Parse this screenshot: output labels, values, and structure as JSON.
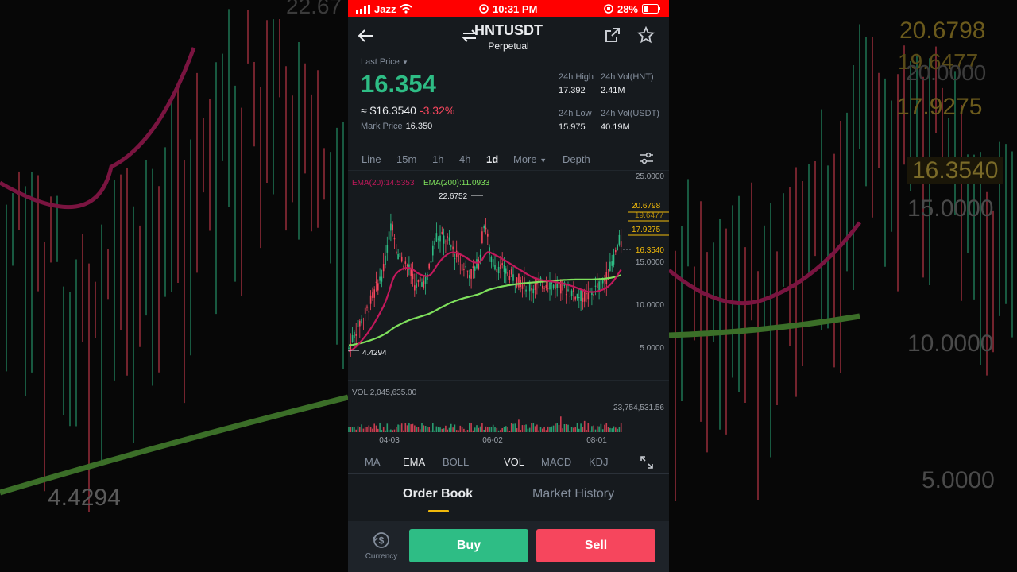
{
  "status_bar": {
    "carrier": "Jazz",
    "time": "10:31 PM",
    "battery": "28%"
  },
  "header": {
    "symbol": "HNTUSDT",
    "contract": "Perpetual"
  },
  "ticker": {
    "last_price_label": "Last Price",
    "last_price": "16.354",
    "usd_value": "≈ $16.3540",
    "change_pct": "-3.32%",
    "mark_price_label": "Mark Price",
    "mark_price": "16.350",
    "high_24h_label": "24h High",
    "high_24h": "17.392",
    "vol_hnt_label": "24h Vol(HNT)",
    "vol_hnt": "2.41M",
    "low_24h_label": "24h Low",
    "low_24h": "15.975",
    "vol_usdt_label": "24h Vol(USDT)",
    "vol_usdt": "40.19M"
  },
  "timeframes": [
    "Line",
    "15m",
    "1h",
    "4h",
    "1d",
    "More",
    "Depth"
  ],
  "active_timeframe": "1d",
  "chart": {
    "ema20_label": "EMA(20):14.5353",
    "ema200_label": "EMA(200):11.0933",
    "price_ticks": [
      "25.0000",
      "20.0000",
      "15.0000",
      "10.0000",
      "5.0000"
    ],
    "high_marker": "22.6752",
    "low_marker": "4.4294",
    "current_price_tag": "16.3540",
    "right_levels": [
      "20.6798",
      "19.6477",
      "17.9275",
      "16.3540"
    ],
    "vol_label": "VOL:2,045,635.00",
    "vol_max": "23,754,531.56",
    "date_ticks": [
      "04-03",
      "06-02",
      "08-01"
    ]
  },
  "indicators": {
    "main": [
      "MA",
      "EMA",
      "BOLL"
    ],
    "sub": [
      "VOL",
      "MACD",
      "KDJ"
    ],
    "active_main": "EMA",
    "active_sub": "VOL"
  },
  "tabs": {
    "order_book": "Order Book",
    "market_history": "Market History"
  },
  "bottom_bar": {
    "currency_label": "Currency",
    "buy": "Buy",
    "sell": "Sell"
  },
  "background_labels": {
    "left_top": "22.67",
    "left_price": "4.4294",
    "right_levels": [
      "20.6798",
      "19.6477",
      "20.0000",
      "17.9275",
      "16.3540",
      "15.0000",
      "10.0000",
      "5.0000"
    ]
  },
  "colors": {
    "up": "#2ebd85",
    "down": "#f6465d",
    "accent": "#f0b90b",
    "ema20": "#c2185b",
    "ema200": "#7ee05c",
    "status_bar": "#ff0000"
  }
}
